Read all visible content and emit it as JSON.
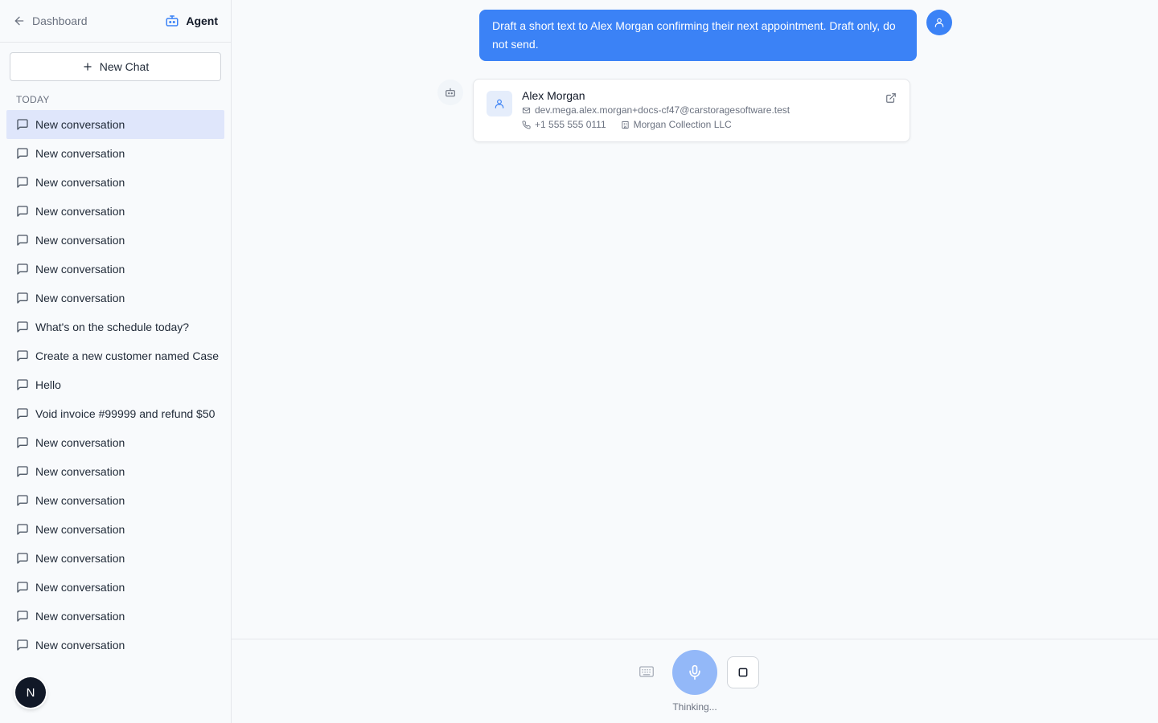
{
  "sidebar": {
    "back_label": "Dashboard",
    "agent_label": "Agent",
    "new_chat_label": "New Chat",
    "section_label": "TODAY",
    "conversations": [
      "New conversation",
      "New conversation",
      "New conversation",
      "New conversation",
      "New conversation",
      "New conversation",
      "New conversation",
      "What's on the schedule today?",
      "Create a new customer named Case",
      "Hello",
      "Void invoice #99999 and refund $50",
      "New conversation",
      "New conversation",
      "New conversation",
      "New conversation",
      "New conversation",
      "New conversation",
      "New conversation",
      "New conversation"
    ],
    "active_index": 0,
    "user_initial": "N"
  },
  "chat": {
    "user_message": "Draft a short text to Alex Morgan confirming their next appointment. Draft only, do not send.",
    "contact": {
      "name": "Alex Morgan",
      "email": "dev.mega.alex.morgan+docs-cf47@carstoragesoftware.test",
      "phone": "+1 555 555 0111",
      "company": "Morgan Collection LLC"
    }
  },
  "controls": {
    "status": "Thinking..."
  },
  "colors": {
    "accent": "#3b82f6",
    "mic": "#93b8f8",
    "active_item": "#dfe6fb"
  },
  "icons": {
    "back": "arrow-left-icon",
    "agent": "robot-icon",
    "new_chat": "plus-icon",
    "conversation": "message-square-icon",
    "user": "user-icon",
    "email": "mail-icon",
    "phone": "phone-icon",
    "company": "building-icon",
    "external": "external-link-icon",
    "keyboard": "keyboard-icon",
    "mic": "mic-icon",
    "stop": "stop-square-icon"
  }
}
